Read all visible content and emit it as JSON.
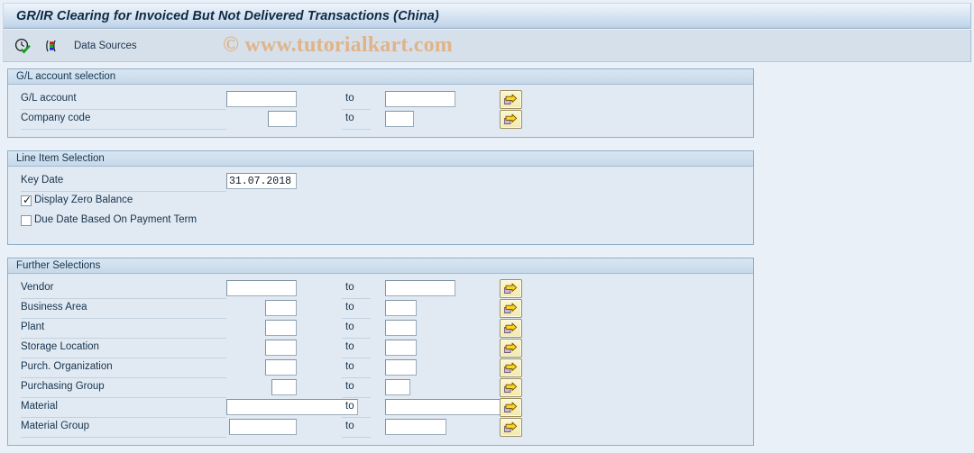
{
  "window": {
    "title": "GR/IR Clearing for Invoiced But Not Delivered Transactions (China)"
  },
  "toolbar": {
    "execute_icon": "clock-check-icon",
    "datasource_icon": "data-sources-icon",
    "data_sources_label": "Data Sources"
  },
  "watermark": {
    "text": "© www.tutorialkart.com",
    "color": "#e2b183"
  },
  "common": {
    "to_label": "to",
    "multi_select_icon": "multiple-selection-arrow-icon",
    "field_placeholder": ""
  },
  "sections": [
    {
      "id": "gl-account-selection",
      "title": "G/L account selection",
      "rows": [
        {
          "id": "gl-account",
          "label": "G/L account",
          "from_value": "",
          "to_value": "",
          "from_width": 78,
          "to_width": 78,
          "multi_select": true
        },
        {
          "id": "company-code",
          "label": "Company code",
          "from_value": "",
          "to_value": "",
          "from_width": 32,
          "to_width": 32,
          "multi_select": true
        }
      ]
    },
    {
      "id": "line-item-selection",
      "title": "Line Item Selection",
      "key_date": {
        "label": "Key Date",
        "value": "31.07.2018",
        "width": 78
      },
      "checkboxes": [
        {
          "id": "display-zero-balance",
          "label": "Display Zero Balance",
          "checked": true,
          "mark": "✓"
        },
        {
          "id": "due-date-based-payment-term",
          "label": "Due Date Based On Payment Term",
          "checked": false,
          "mark": ""
        }
      ]
    },
    {
      "id": "further-selections",
      "title": "Further Selections",
      "rows": [
        {
          "id": "vendor",
          "label": "Vendor",
          "from_value": "",
          "to_value": "",
          "from_width": 78,
          "to_width": 78,
          "multi_select": true
        },
        {
          "id": "business-area",
          "label": "Business Area",
          "from_value": "",
          "to_value": "",
          "from_width": 35,
          "to_width": 35,
          "multi_select": true
        },
        {
          "id": "plant",
          "label": "Plant",
          "from_value": "",
          "to_value": "",
          "from_width": 35,
          "to_width": 35,
          "multi_select": true
        },
        {
          "id": "storage-location",
          "label": "Storage Location",
          "from_value": "",
          "to_value": "",
          "from_width": 35,
          "to_width": 35,
          "multi_select": true
        },
        {
          "id": "purch-organization",
          "label": "Purch. Organization",
          "from_value": "",
          "to_value": "",
          "from_width": 35,
          "to_width": 35,
          "multi_select": true
        },
        {
          "id": "purchasing-group",
          "label": "Purchasing Group",
          "from_value": "",
          "to_value": "",
          "from_width": 28,
          "to_width": 28,
          "multi_select": true
        },
        {
          "id": "material",
          "label": "Material",
          "from_value": "",
          "to_value": "",
          "from_width": 146,
          "to_width": 134,
          "multi_select": true
        },
        {
          "id": "material-group",
          "label": "Material Group",
          "from_value": "",
          "to_value": "",
          "from_width": 75,
          "to_width": 68,
          "multi_select": true
        }
      ]
    }
  ]
}
